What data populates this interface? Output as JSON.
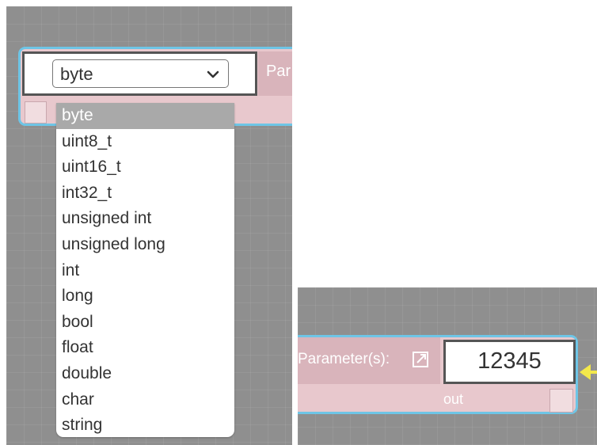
{
  "left_node": {
    "type_select": {
      "selected": "byte",
      "options": [
        "byte",
        "uint8_t",
        "uint16_t",
        "int32_t",
        "unsigned int",
        "unsigned long",
        "int",
        "long",
        "bool",
        "float",
        "double",
        "char",
        "string"
      ]
    },
    "parameter_label_partial": "Par"
  },
  "right_node": {
    "parameter_label": "Parameter(s):",
    "value": "12345",
    "output_label": "out"
  },
  "colors": {
    "canvas": "#8f8f8f",
    "node_border": "#6ec5e6",
    "node_body": "#e8c8cd",
    "label_area": "#d9b4bb",
    "selected_option": "#a9a9a9",
    "connector_arrow": "#f3e84b"
  },
  "icons": {
    "select_chevron": "chevron-down-icon",
    "open_external": "external-link-icon",
    "connector": "arrow-left-icon"
  }
}
